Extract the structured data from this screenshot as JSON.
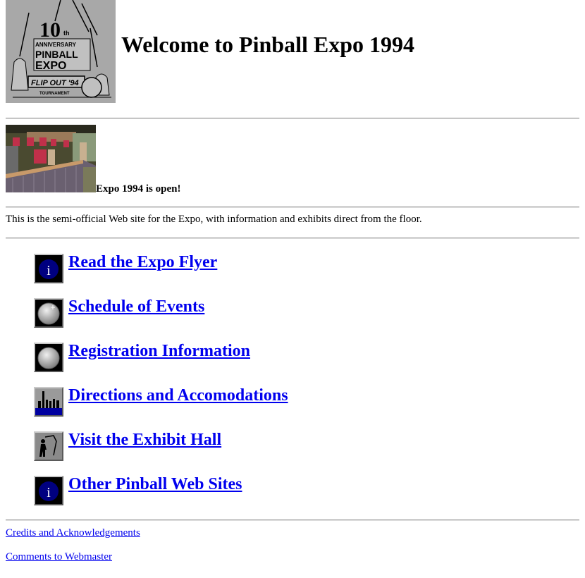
{
  "page": {
    "title": "Welcome to Pinball Expo 1994"
  },
  "logo": {
    "icon": "pinball-expo-10th-anniversary-logo",
    "alt_lines": [
      "10th",
      "ANNIVERSARY",
      "PINBALL",
      "EXPO",
      "FLIP OUT '94",
      "TOURNAMENT"
    ]
  },
  "banner": {
    "photo_icon": "expo-floor-photo",
    "caption": "Expo 1994 is open!"
  },
  "intro": "This is the semi-official Web site for the Expo, with information and exhibits direct from the floor.",
  "menu": [
    {
      "label": "Read the Expo Flyer",
      "icon": "info-icon"
    },
    {
      "label": "Schedule of Events",
      "icon": "pinball-icon"
    },
    {
      "label": "Registration Information",
      "icon": "pinball-icon"
    },
    {
      "label": "Directions and Accomodations",
      "icon": "city-skyline-icon"
    },
    {
      "label": "Visit the Exhibit Hall",
      "icon": "pinball-player-icon"
    },
    {
      "label": "Other Pinball Web Sites",
      "icon": "info-icon"
    }
  ],
  "footer": {
    "credits": "Credits and Acknowledgements",
    "comments": "Comments to Webmaster"
  },
  "colors": {
    "link": "#0000ee",
    "info_circle": "#000080"
  }
}
